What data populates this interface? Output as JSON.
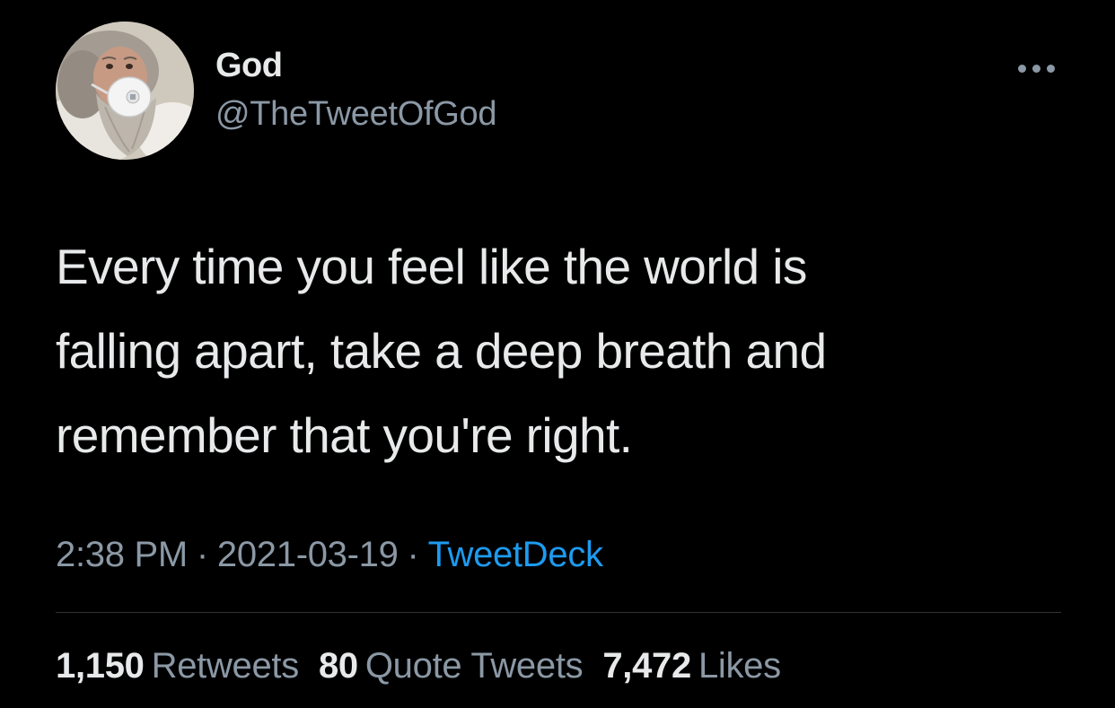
{
  "author": {
    "display_name": "God",
    "handle": "@TheTweetOfGod",
    "avatar_icon": "bearded-man-with-mask-avatar"
  },
  "menu": {
    "icon": "more-options-icon"
  },
  "tweet": {
    "lines": [
      "Every time you feel like the world is",
      "falling apart, take a deep breath and",
      "remember that you're right."
    ]
  },
  "meta": {
    "time": "2:38 PM",
    "separator": "·",
    "date": "2021-03-19",
    "source": "TweetDeck"
  },
  "stats": {
    "retweets_count": "1,150",
    "retweets_label": "Retweets",
    "quotes_count": "80",
    "quotes_label": "Quote Tweets",
    "likes_count": "7,472",
    "likes_label": "Likes"
  },
  "colors": {
    "background": "#000000",
    "text_primary": "#e7e9ea",
    "text_secondary": "#8b98a5",
    "link": "#1d9bf0",
    "divider": "#2f3336"
  }
}
